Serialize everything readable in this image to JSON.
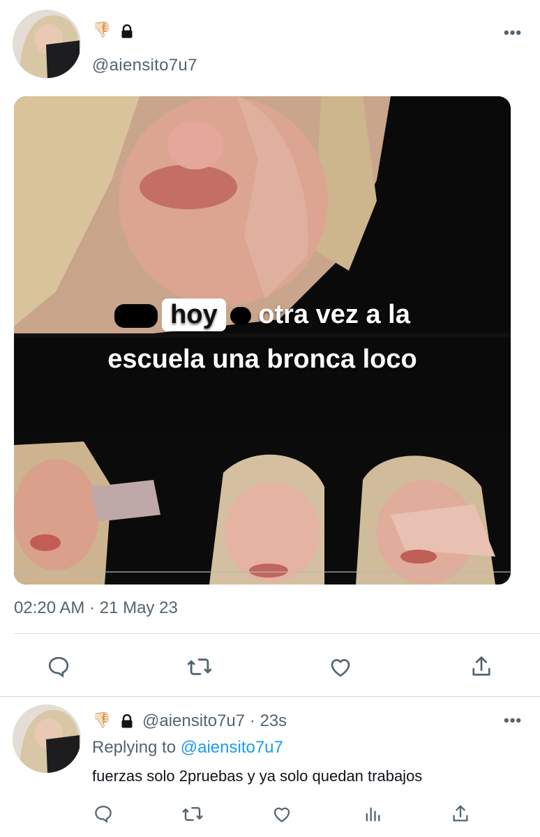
{
  "main_tweet": {
    "emoji": "👎🏻",
    "lock_icon": "lock-icon",
    "handle": "@aiensito7u7",
    "more_label": "•••",
    "media_caption": {
      "boxed_word": "hoy",
      "line1_rest": "otra vez a la",
      "line2": "escuela una bronca loco"
    },
    "timestamp": "02:20 AM · 21 May 23",
    "actions": [
      "reply-icon",
      "retweet-icon",
      "like-icon",
      "share-icon"
    ]
  },
  "reply_tweet": {
    "emoji": "👎🏻",
    "lock_icon": "lock-icon",
    "handle": "@aiensito7u7",
    "separator": "·",
    "time": "23s",
    "more_label": "•••",
    "replying_prefix": "Replying to",
    "replying_handle": "@aiensito7u7",
    "text": "fuerzas solo 2pruebas y ya solo quedan trabajos",
    "actions": [
      "reply-icon",
      "retweet-icon",
      "like-icon",
      "views-icon",
      "share-icon"
    ]
  },
  "colors": {
    "text": "#0f1419",
    "muted": "#536471",
    "link": "#1d9bf0",
    "divider": "#cfd9de"
  }
}
